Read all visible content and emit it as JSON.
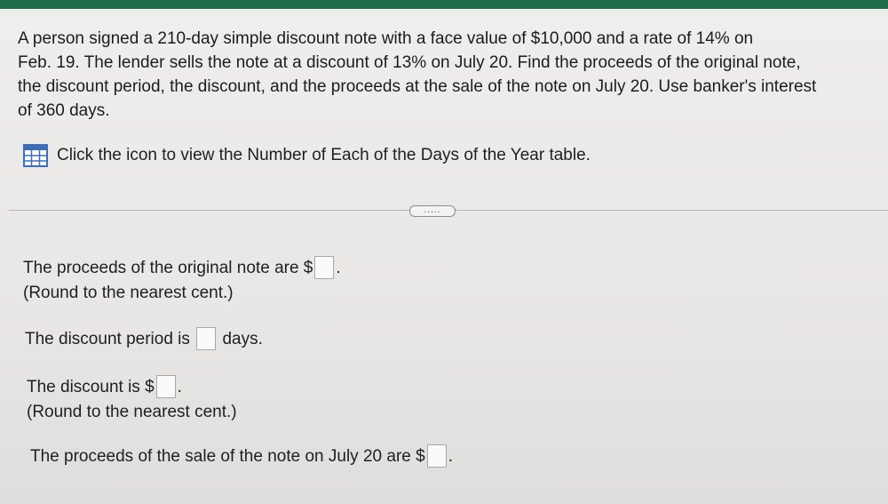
{
  "question": {
    "lines": [
      "A person signed a 210-day simple discount note with a face value of $10,000 and a rate of 14% on",
      "Feb. 19. The lender sells the note at a discount of 13% on July 20. Find the proceeds of the original note,",
      "the discount period, the discount, and the proceeds at the sale of the note on July 20. Use banker's interest",
      "of 360 days."
    ]
  },
  "table_link": {
    "icon": "table-grid-icon",
    "label": "Click the icon to view the Number of Each of the Days of the Year table."
  },
  "more_button": {
    "label": "....."
  },
  "answers": {
    "proceeds_original": {
      "prefix": "The proceeds of the original note are $",
      "suffix": ".",
      "note": "(Round to the nearest cent.)",
      "value": ""
    },
    "discount_period": {
      "prefix": "The discount period is",
      "suffix": "days.",
      "value": ""
    },
    "discount": {
      "prefix": "The discount is $",
      "suffix": ".",
      "note": "(Round to the nearest cent.)",
      "value": ""
    },
    "proceeds_sale": {
      "prefix": "The proceeds of the sale of the note on July 20 are $",
      "suffix": ".",
      "value": ""
    }
  },
  "colors": {
    "top_bar": "#1f6b4a",
    "icon_blue": "#3d6fb8"
  }
}
